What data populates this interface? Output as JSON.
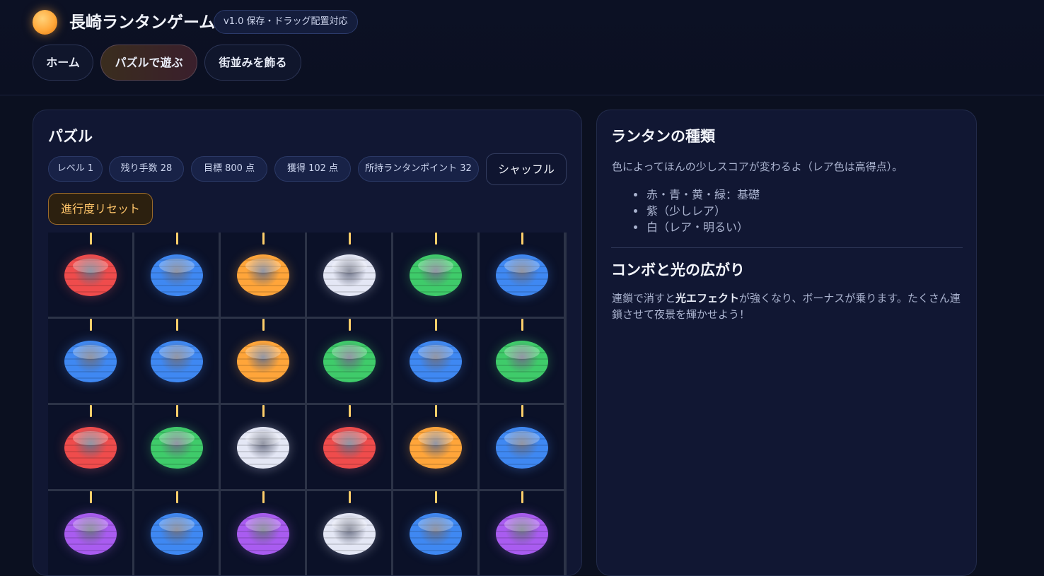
{
  "app": {
    "title": "長崎ランタンゲーム",
    "version_badge": "v1.0 保存・ドラッグ配置対応"
  },
  "nav": {
    "tabs": [
      {
        "label": "ホーム",
        "active": false
      },
      {
        "label": "パズルで遊ぶ",
        "active": true
      },
      {
        "label": "街並みを飾る",
        "active": false
      }
    ]
  },
  "puzzle": {
    "title": "パズル",
    "stats": {
      "level": "レベル 1",
      "moves_left": "残り手数 28",
      "target": "目標 800 点",
      "earned": "獲得 102 点",
      "lantern_points": "所持ランタンポイント 32"
    },
    "shuffle_label": "シャッフル",
    "reset_label": "進行度リセット",
    "board": {
      "columns": 6,
      "visible_rows": 4,
      "rows": [
        [
          "red",
          "blue",
          "yellow",
          "white",
          "green",
          "blue"
        ],
        [
          "blue",
          "blue",
          "yellow",
          "green",
          "blue",
          "green"
        ],
        [
          "red",
          "green",
          "white",
          "red",
          "yellow",
          "blue"
        ],
        [
          "purple",
          "blue",
          "purple",
          "white",
          "blue",
          "purple"
        ]
      ]
    }
  },
  "lantern_colors": {
    "red": "#ef4c4c",
    "blue": "#3f88f2",
    "yellow": "#ffa53a",
    "green": "#3fcb6a",
    "white": "#e4e7f5",
    "purple": "#a95cf0"
  },
  "info": {
    "types_title": "ランタンの種類",
    "types_desc": "色によってほんの少しスコアが変わるよ（レア色は高得点）。",
    "types_list": [
      "赤・青・黄・緑：基礎",
      "紫（少しレア）",
      "白（レア・明るい）"
    ],
    "combo_title": "コンボと光の広がり",
    "combo_desc_pre": "連鎖で消すと",
    "combo_desc_bold": "光エフェクト",
    "combo_desc_post": "が強くなり、ボーナスが乗ります。たくさん連鎖させて夜景を輝かせよう！"
  },
  "colors": {
    "accent_orange": "#ffa83a",
    "background": "#0b1020",
    "panel": "#111733"
  }
}
